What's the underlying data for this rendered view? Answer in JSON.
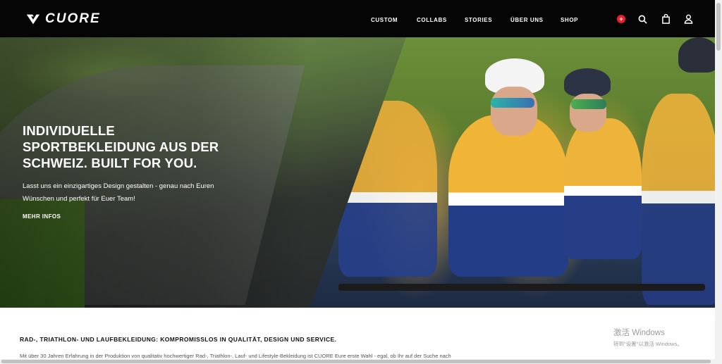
{
  "header": {
    "brand": "CUORE",
    "nav": [
      "CUSTOM",
      "COLLABS",
      "STORIES",
      "ÜBER UNS",
      "SHOP"
    ],
    "icons": [
      "swiss-flag-icon",
      "search-icon",
      "cart-icon",
      "user-icon"
    ],
    "flag_symbol": "+"
  },
  "hero": {
    "title": "INDIVIDUELLE SPORTBEKLEIDUNG AUS DER SCHWEIZ. BUILT FOR YOU.",
    "subtitle": "Lasst uns ein einzigartiges Design gestalten - genau nach Euren Wünschen und perfekt für Euer Team!",
    "cta": "MEHR INFOS"
  },
  "content": {
    "heading": "RAD-, TRIATHLON- UND LAUFBEKLEIDUNG: KOMPROMISSLOS IN QUALITÄT, DESIGN UND SERVICE.",
    "text": "Mit über 30 Jahren Erfahrung in der Produktion von qualitativ hochwertiger Rad-, Triathlon-, Lauf- und Lifestyle-Bekleidung ist CUORE Eure erste Wahl - egal, ob Ihr auf der Suche nach"
  },
  "watermark": {
    "line1": "激活 Windows",
    "line2": "转到\"设置\"以激活 Windows。"
  },
  "colors": {
    "header_bg": "#050505",
    "accent_red": "#e8202b",
    "jersey_yellow": "#f0b437",
    "jersey_blue": "#233d86"
  }
}
